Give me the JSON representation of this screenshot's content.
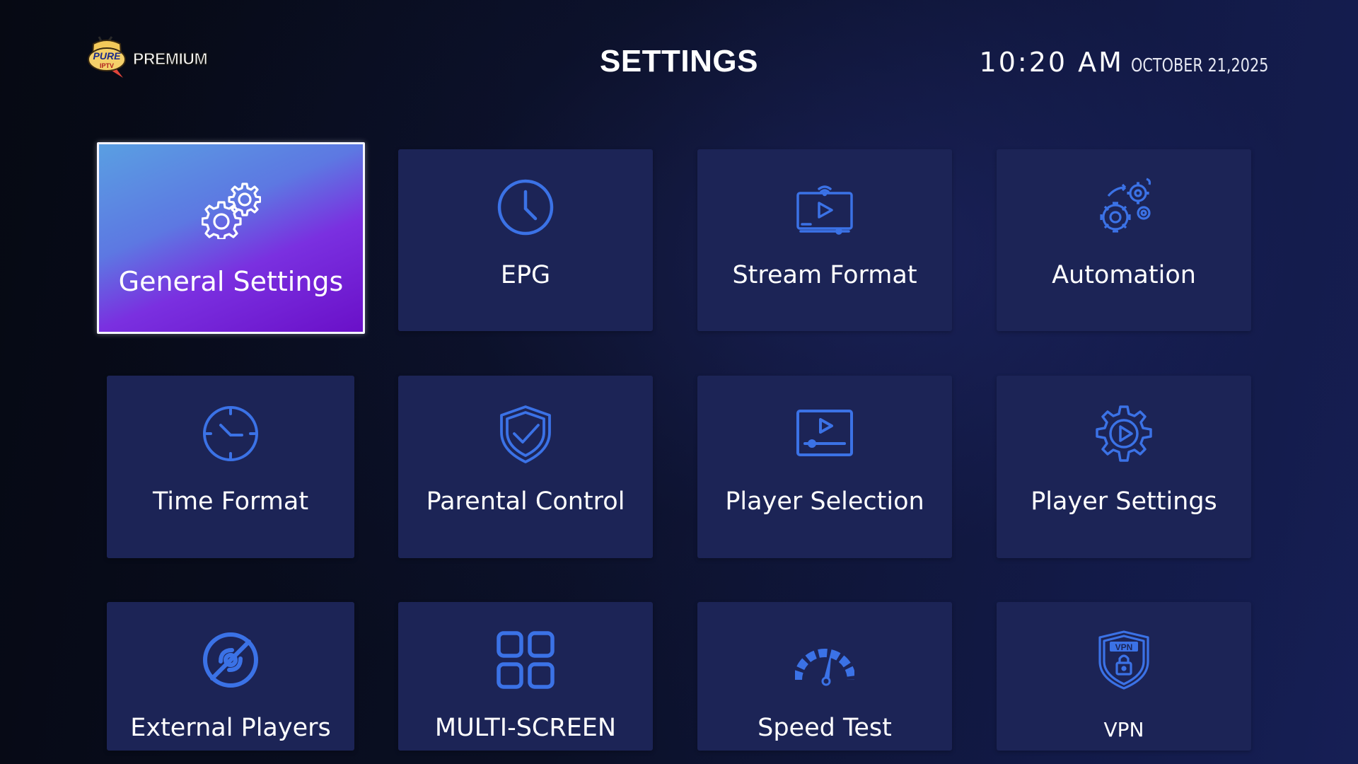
{
  "header": {
    "logo": {
      "badge_line1": "PURE",
      "badge_line2": "IPTV",
      "wordmark": "PREMIUM"
    },
    "title": "SETTINGS",
    "time": "10:20 AM",
    "date": "OCTOBER 21,2025"
  },
  "colors": {
    "tile_background": "#1c2456",
    "icon_blue": "#3b72e6",
    "selected_gradient_start": "#5a9fe2",
    "selected_gradient_end": "#6a10c8",
    "page_background": "#0a0f24"
  },
  "tiles": [
    {
      "label": "General Settings",
      "icon": "gears-icon",
      "selected": true
    },
    {
      "label": "EPG",
      "icon": "clock-icon",
      "selected": false
    },
    {
      "label": "Stream Format",
      "icon": "stream-screen-icon",
      "selected": false
    },
    {
      "label": "Automation",
      "icon": "automation-gears-icon",
      "selected": false
    },
    {
      "label": "Time Format",
      "icon": "time-clock-icon",
      "selected": false
    },
    {
      "label": "Parental Control",
      "icon": "shield-check-icon",
      "selected": false
    },
    {
      "label": "Player Selection",
      "icon": "player-screen-icon",
      "selected": false
    },
    {
      "label": "Player Settings",
      "icon": "gear-play-icon",
      "selected": false
    },
    {
      "label": "External Players",
      "icon": "disc-off-icon",
      "selected": false
    },
    {
      "label": "MULTI-SCREEN",
      "icon": "grid-icon",
      "selected": false
    },
    {
      "label": "Speed Test",
      "icon": "speedometer-icon",
      "selected": false
    },
    {
      "label": "VPN",
      "icon": "vpn-shield-icon",
      "selected": false
    }
  ]
}
